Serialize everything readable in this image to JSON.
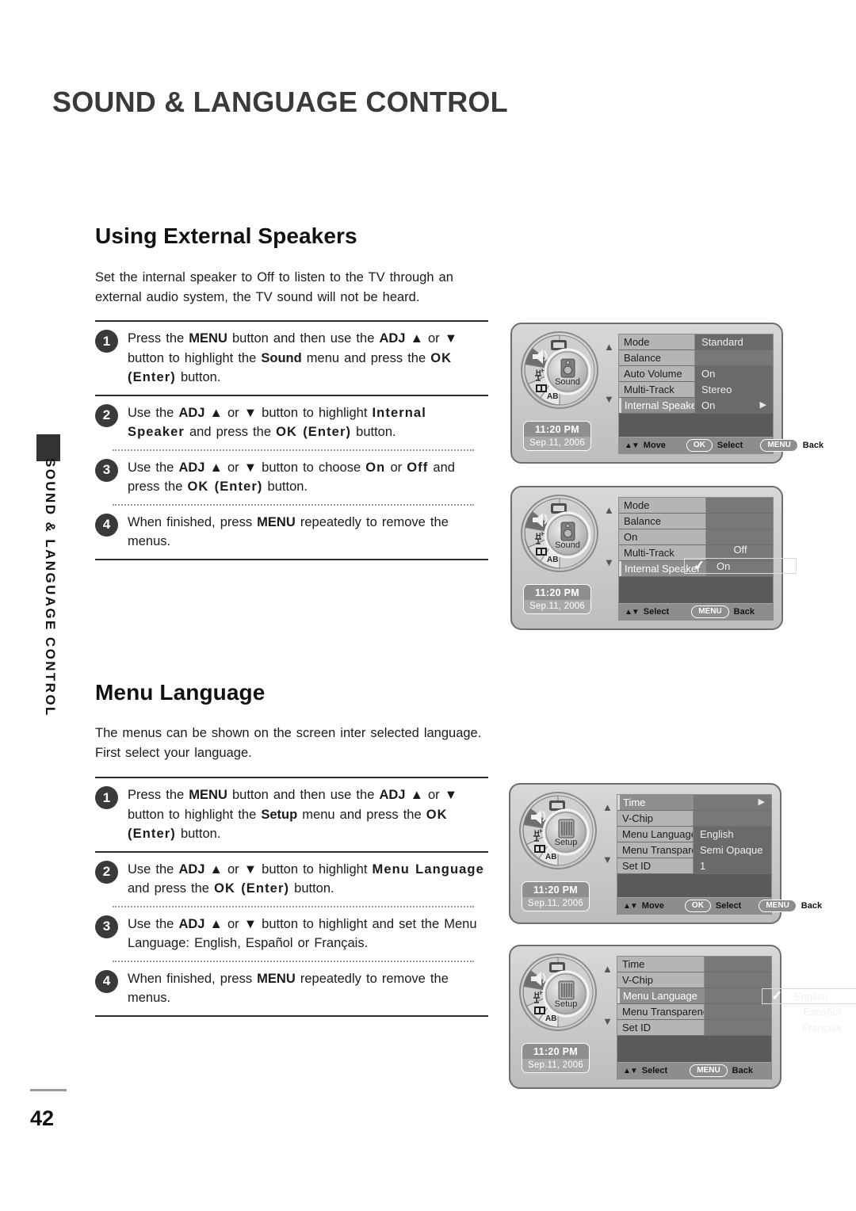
{
  "page": {
    "header_title": "SOUND & LANGUAGE CONTROL",
    "side_tab_text": "SOUND & LANGUAGE CONTROL",
    "page_number": "42"
  },
  "sections": [
    {
      "heading": "Using External Speakers",
      "intro": "Set the internal speaker to Off to listen to the TV through an external audio system, the TV sound will not be heard.",
      "steps": [
        {
          "num": "1",
          "html": "Press the <b>MENU</b> button and then use the <b>ADJ</b> ▲ or ▼ button to highlight the <b>Sound</b> menu and press the <span class=\"sp\">OK</span> <span class=\"sp\">(Enter)</span> button."
        },
        {
          "num": "2",
          "html": "Use the <b>ADJ</b> ▲ or ▼ button to highlight <span class=\"sp\">Internal Speaker</span> and press the <span class=\"sp\">OK (Enter)</span> button."
        },
        {
          "num": "3",
          "html": "Use the <b>ADJ</b> ▲ or ▼ button to choose <span class=\"sp\">On</span> or <span class=\"sp\">Off</span> and press the <span class=\"sp\">OK (Enter)</span> button."
        },
        {
          "num": "4",
          "html": "When finished, press <b>MENU</b> repeatedly to remove the menus."
        }
      ]
    },
    {
      "heading": "Menu Language",
      "intro": "The menus can be shown on the screen inter selected language. First select your language.",
      "steps": [
        {
          "num": "1",
          "html": "Press the <b>MENU</b> button and then use the <b>ADJ</b> ▲ or ▼ button to highlight the <b>Setup</b> menu and press the <span class=\"sp\">OK</span> <span class=\"sp\">(Enter)</span> button."
        },
        {
          "num": "2",
          "html": "Use the <b>ADJ</b> ▲ or ▼ button to highlight <span class=\"sp\">Menu Language</span> and press the <span class=\"sp\">OK (Enter)</span> button."
        },
        {
          "num": "3",
          "html": "Use the <b>ADJ</b> ▲ or ▼ button to highlight and set the Menu Language: English, Español or Français."
        },
        {
          "num": "4",
          "html": "When finished, press <b>MENU</b> repeatedly to remove the menus."
        }
      ]
    }
  ],
  "osd_screens": [
    {
      "id": "sound-menu",
      "wheel_label": "Sound",
      "clock_time": "11:20 PM",
      "clock_date": "Sep.11, 2006",
      "rows": [
        {
          "label": "Mode",
          "value": "Standard",
          "selected": false,
          "caret": false
        },
        {
          "label": "Balance",
          "value": "",
          "selected": false,
          "caret": false
        },
        {
          "label": "Auto Volume",
          "value": "On",
          "selected": false,
          "caret": false
        },
        {
          "label": "Multi-Track",
          "value": "Stereo",
          "selected": false,
          "caret": false
        },
        {
          "label": "Internal Speaker",
          "value": "On",
          "selected": true,
          "caret": true
        }
      ],
      "footer": {
        "move": "Move",
        "ok": "OK",
        "select": "Select",
        "menu": "MENU",
        "back": "Back"
      }
    },
    {
      "id": "sound-internal-speaker-popup",
      "wheel_label": "Sound",
      "clock_time": "11:20 PM",
      "clock_date": "Sep.11, 2006",
      "rows": [
        {
          "label": "Mode",
          "selected": false
        },
        {
          "label": "Balance",
          "selected": false
        },
        {
          "label": "On",
          "selected": false
        },
        {
          "label": "Multi-Track",
          "selected": false
        },
        {
          "label": "Internal Speaker",
          "selected": true
        }
      ],
      "popup": {
        "options": [
          "Off",
          "On"
        ],
        "checked": "On"
      },
      "footer": {
        "select": "Select",
        "menu": "MENU",
        "back": "Back"
      }
    },
    {
      "id": "setup-menu",
      "wheel_label": "Setup",
      "clock_time": "11:20 PM",
      "clock_date": "Sep.11, 2006",
      "rows": [
        {
          "label": "Time",
          "value": "",
          "selected": true,
          "caret": true
        },
        {
          "label": "V-Chip",
          "value": "",
          "selected": false,
          "caret": false
        },
        {
          "label": "Menu Language",
          "value": "English",
          "selected": false,
          "caret": false
        },
        {
          "label": "Menu Transparency",
          "value": "Semi Opaque",
          "selected": false,
          "caret": false
        },
        {
          "label": "Set ID",
          "value": "1",
          "selected": false,
          "caret": false
        }
      ],
      "footer": {
        "move": "Move",
        "ok": "OK",
        "select": "Select",
        "menu": "MENU",
        "back": "Back"
      }
    },
    {
      "id": "setup-language-popup",
      "wheel_label": "Setup",
      "clock_time": "11:20 PM",
      "clock_date": "Sep.11, 2006",
      "rows": [
        {
          "label": "Time",
          "selected": false
        },
        {
          "label": "V-Chip",
          "selected": false
        },
        {
          "label": "Menu Language",
          "selected": true
        },
        {
          "label": "Menu Transparency",
          "selected": false
        },
        {
          "label": "Set ID",
          "selected": false
        }
      ],
      "popup": {
        "options": [
          "English",
          "Español",
          "Français"
        ],
        "checked": "English"
      },
      "footer": {
        "select": "Select",
        "menu": "MENU",
        "back": "Back"
      }
    }
  ],
  "icons": {
    "wheel_segments": [
      "picture-icon",
      "speaker-icon",
      "channel-icon",
      "screen-icon",
      "ab-icon"
    ],
    "arrow_up": "▲",
    "arrow_down": "▼",
    "caret_right": "▶",
    "check": "✓"
  }
}
